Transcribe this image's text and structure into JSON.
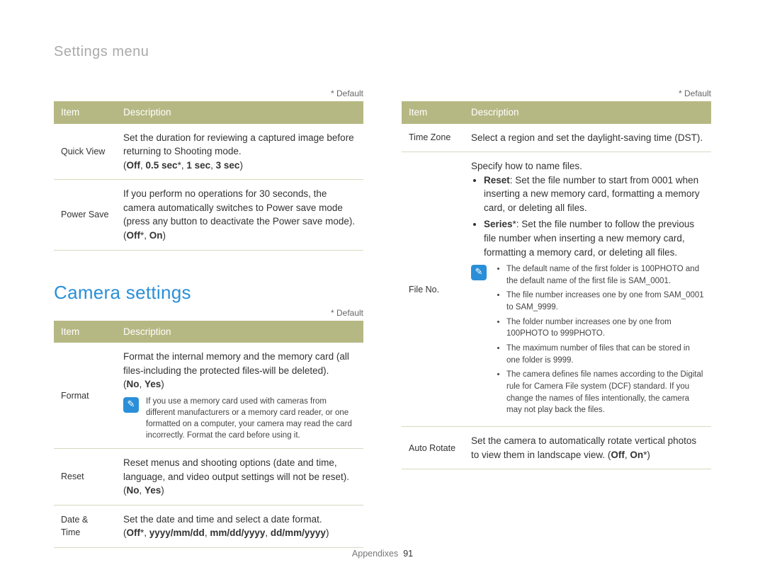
{
  "breadcrumb": "Settings menu",
  "default_label": "* Default",
  "table_headers": {
    "item": "Item",
    "description": "Description"
  },
  "section_heading": "Camera settings",
  "left_top": {
    "rows": [
      {
        "item": "Quick View",
        "desc": "Set the duration for reviewing a captured image before returning to Shooting mode.",
        "options_html": "(<b>Off</b>, <b>0.5 sec</b>*, <b>1 sec</b>, <b>3 sec</b>)"
      },
      {
        "item": "Power Save",
        "desc_html": "If you perform no operations for 30 seconds, the camera automatically switches to Power save mode (press any button to deactivate the Power save mode). (<b>Off</b>*, <b>On</b>)"
      }
    ]
  },
  "left_bottom": {
    "rows": [
      {
        "item": "Format",
        "desc": "Format the internal memory and the memory card (all files-including the protected files-will be deleted).",
        "options_html": "(<b>No</b>, <b>Yes</b>)",
        "note": "If you use a memory card used with cameras from different manufacturers or a memory card reader, or one formatted on a computer, your camera may read the card incorrectly. Format the card before using it."
      },
      {
        "item": "Reset",
        "desc": "Reset menus and shooting options (date and time, language, and video output settings will not be reset).",
        "options_html": "(<b>No</b>, <b>Yes</b>)"
      },
      {
        "item": "Date & Time",
        "desc": "Set the date and time and select a date format.",
        "options_html": "(<b>Off</b>*, <b>yyyy/mm/dd</b>, <b>mm/dd/yyyy</b>, <b>dd/mm/yyyy</b>)"
      }
    ]
  },
  "right": {
    "rows": [
      {
        "item": "Time Zone",
        "desc": "Select a region and set the daylight-saving time (DST)."
      },
      {
        "item": "File No.",
        "intro": "Specify how to name files.",
        "bullets_html": [
          "<b>Reset</b>: Set the file number to start from 0001 when inserting a new memory card, formatting a memory card, or deleting all files.",
          "<b>Series</b>*: Set the file number to follow the previous file number when inserting a new memory card, formatting a memory card, or deleting all files."
        ],
        "note_bullets": [
          "The default name of the first folder is 100PHOTO and the default name of the first file is SAM_0001.",
          "The file number increases one by one from SAM_0001 to SAM_9999.",
          "The folder number increases one by one from 100PHOTO to 999PHOTO.",
          "The maximum number of files that can be stored in one folder is 9999.",
          "The camera defines file names according to the Digital rule for Camera File system (DCF) standard. If you change the names of files intentionally, the camera may not play back the files."
        ]
      },
      {
        "item": "Auto Rotate",
        "desc_html": "Set the camera to automatically rotate vertical photos to view them in landscape view. (<b>Off</b>, <b>On</b>*)"
      }
    ]
  },
  "footer": {
    "section": "Appendixes",
    "page": "91"
  }
}
